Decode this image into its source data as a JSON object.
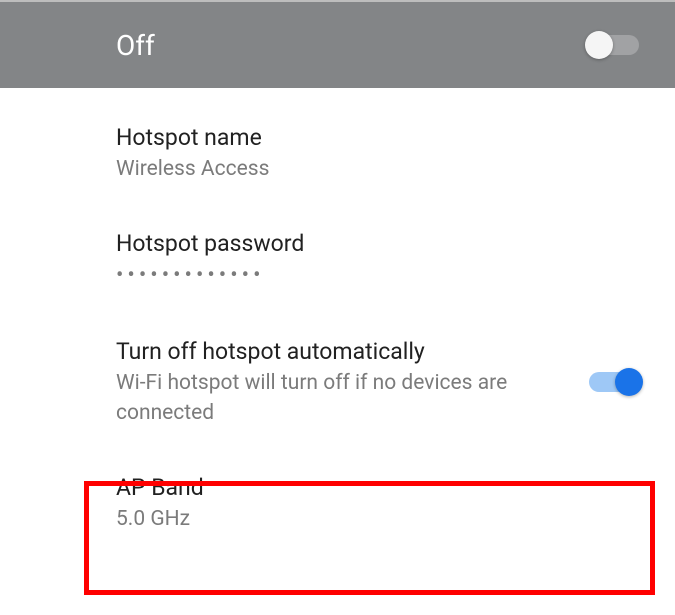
{
  "header": {
    "status_label": "Off",
    "toggle_state": "off"
  },
  "settings": {
    "hotspot_name": {
      "title": "Hotspot name",
      "value": "Wireless Access"
    },
    "hotspot_password": {
      "title": "Hotspot password",
      "value_masked": "•••••••••••••"
    },
    "auto_off": {
      "title": "Turn off hotspot automatically",
      "description": "Wi-Fi hotspot will turn off if no devices are connected",
      "toggle_state": "on"
    },
    "ap_band": {
      "title": "AP Band",
      "value": "5.0 GHz"
    }
  },
  "highlight": {
    "target": "ap-band-row",
    "color": "#ff0000"
  }
}
